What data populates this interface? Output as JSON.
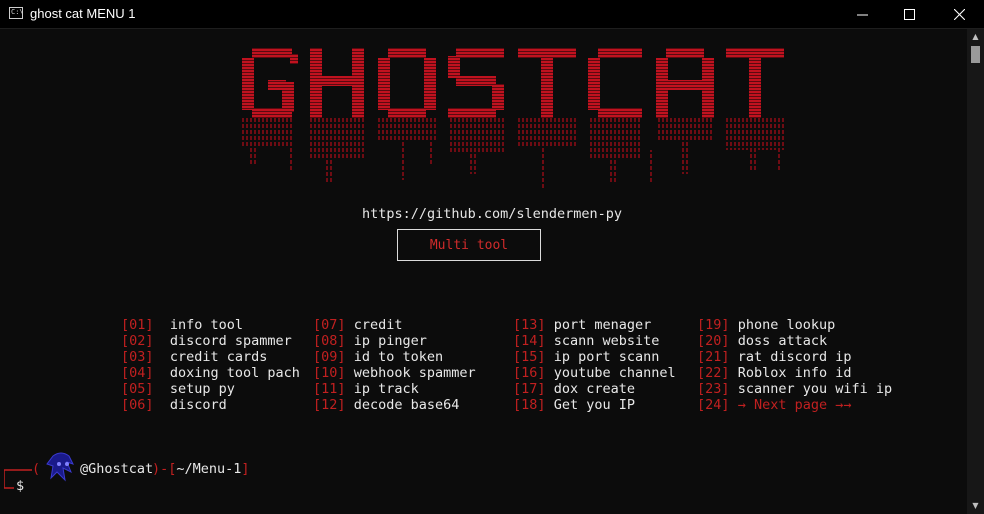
{
  "window": {
    "title": "ghost cat MENU 1",
    "app_icon_text": "C:\\",
    "minimize_icon": "minimize-icon",
    "maximize_icon": "maximize-icon",
    "close_icon": "close-icon"
  },
  "banner": {
    "logo_text": "GHOSTCAT",
    "logo_color": "#c0121f",
    "url": "https://github.com/slendermen-py",
    "button_label": "Multi tool"
  },
  "menu": {
    "col1": [
      {
        "num": "01",
        "label": "info tool"
      },
      {
        "num": "02",
        "label": "discord spammer"
      },
      {
        "num": "03",
        "label": "credit cards"
      },
      {
        "num": "04",
        "label": "doxing tool pach"
      },
      {
        "num": "05",
        "label": "setup py"
      },
      {
        "num": "06",
        "label": "discord"
      }
    ],
    "col2": [
      {
        "num": "07",
        "label": "credit"
      },
      {
        "num": "08",
        "label": "ip pinger"
      },
      {
        "num": "09",
        "label": "id to token"
      },
      {
        "num": "10",
        "label": "webhook spammer"
      },
      {
        "num": "11",
        "label": "ip track"
      },
      {
        "num": "12",
        "label": "decode base64"
      }
    ],
    "col3": [
      {
        "num": "13",
        "label": "port menager"
      },
      {
        "num": "14",
        "label": "scann website"
      },
      {
        "num": "15",
        "label": "ip port scann"
      },
      {
        "num": "16",
        "label": "youtube channel"
      },
      {
        "num": "17",
        "label": "dox create"
      },
      {
        "num": "18",
        "label": "Get you IP"
      }
    ],
    "col4": [
      {
        "num": "19",
        "label": "phone lookup"
      },
      {
        "num": "20",
        "label": "doss attack"
      },
      {
        "num": "21",
        "label": "rat discord ip"
      },
      {
        "num": "22",
        "label": "Roblox info id"
      },
      {
        "num": "23",
        "label": "scanner you wifi ip"
      },
      {
        "num": "24",
        "label": "→ Next page →→"
      }
    ]
  },
  "prompt": {
    "user_suffix": "@Ghostcat",
    "path": "~/Menu-1",
    "symbol": "$"
  },
  "colors": {
    "accent": "#c12020",
    "background": "#0c0c0c",
    "text": "#e8e8e8"
  }
}
